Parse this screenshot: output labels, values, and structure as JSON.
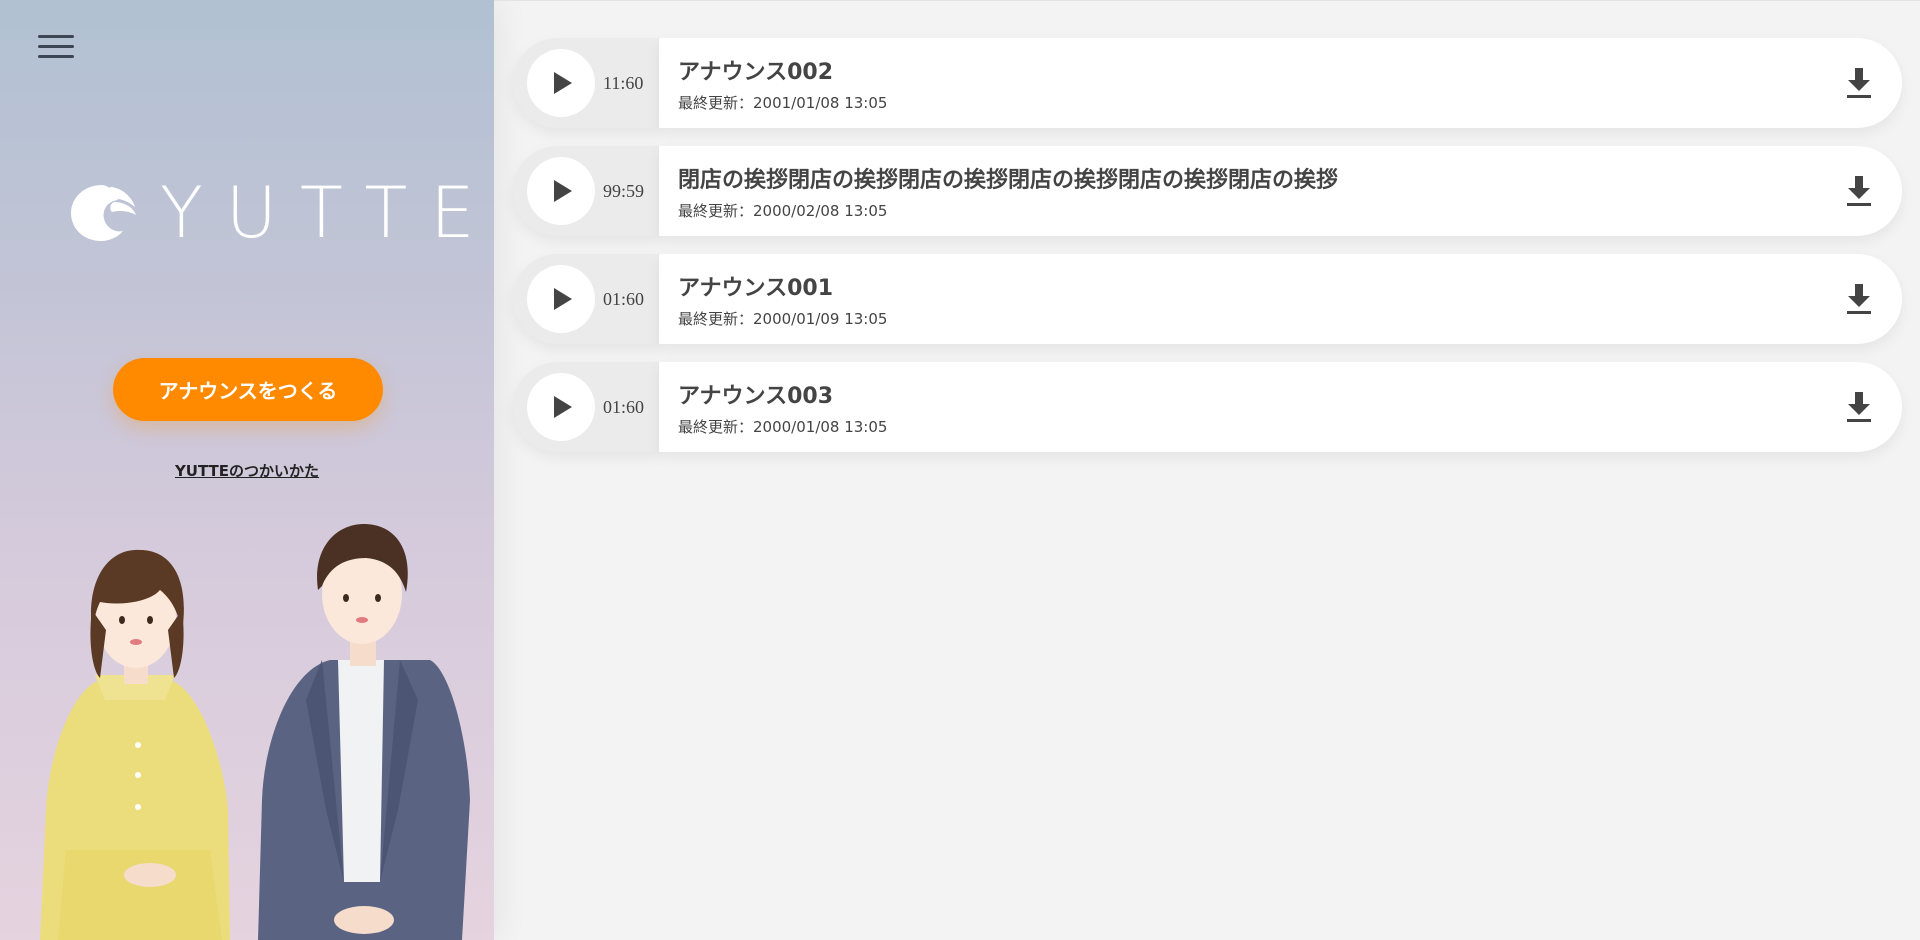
{
  "sidebar": {
    "menu_icon": "hamburger-menu-icon",
    "logo_text": "YUTTE",
    "create_button_label": "アナウンスをつくる",
    "howto_link_label": "YUTTEのつかいかた"
  },
  "announcements": [
    {
      "duration": "11:60",
      "title": "アナウンス002",
      "meta": "最終更新：2001/01/08 13:05"
    },
    {
      "duration": "99:59",
      "title": "閉店の挨拶閉店の挨拶閉店の挨拶閉店の挨拶閉店の挨拶閉店の挨拶",
      "meta": "最終更新：2000/02/08 13:05"
    },
    {
      "duration": "01:60",
      "title": "アナウンス001",
      "meta": "最終更新：2000/01/09 13:05"
    },
    {
      "duration": "01:60",
      "title": "アナウンス003",
      "meta": "最終更新：2000/01/08 13:05"
    }
  ],
  "icons": {
    "play": "play-icon",
    "download": "download-icon"
  },
  "colors": {
    "accent": "#ff8a00",
    "text": "#444444",
    "background": "#f3f3f3"
  }
}
